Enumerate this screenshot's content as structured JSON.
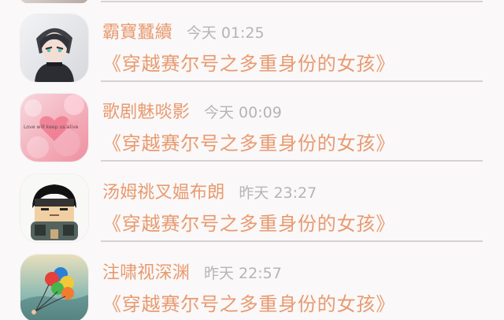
{
  "feed": {
    "items": [
      {
        "username": "霸寶蠶續",
        "time": "今天 01:25",
        "subject": "《穿越赛尔号之多重身份的女孩》"
      },
      {
        "username": "歌剧魅啖影",
        "time": "今天 00:09",
        "subject": "《穿越赛尔号之多重身份的女孩》",
        "avatar_text": "Love will keep us alive"
      },
      {
        "username": "汤姆祧叉媪布朗",
        "time": "昨天 23:27",
        "subject": "《穿越赛尔号之多重身份的女孩》"
      },
      {
        "username": "注啸视深渊",
        "time": "昨天 22:57",
        "subject": "《穿越赛尔号之多重身份的女孩》"
      }
    ]
  },
  "colors": {
    "accent": "#e89a70",
    "timestamp": "#b5b5b5",
    "divider": "#d7d2d0",
    "background": "#faf8f8"
  }
}
